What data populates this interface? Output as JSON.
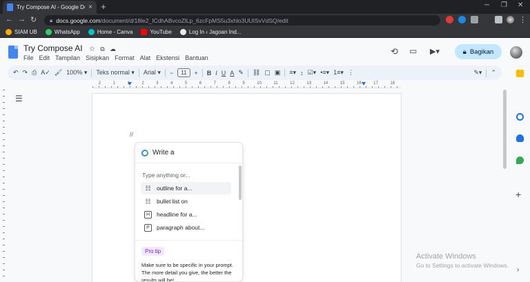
{
  "browser": {
    "tab_title": "Try Compose AI - Google Dokum",
    "new_tab": "+",
    "close": "×",
    "url_host": "docs.google.com",
    "url_path": "/document/d/18le2_ICdhABvcoZlLp_6zcFpMS5u3xhlo3UUISvVdSQ/edit",
    "bookmarks": [
      "SIAM UB",
      "WhatsApp",
      "Home - Canva",
      "YouTube",
      "Log In ‹ Jagoan Ind..."
    ]
  },
  "docs": {
    "title": "Try Compose AI",
    "menu": [
      "File",
      "Edit",
      "Tampilan",
      "Sisipkan",
      "Format",
      "Alat",
      "Ekstensi",
      "Bantuan"
    ],
    "share_label": "Bagikan",
    "toolbar": {
      "zoom": "100%",
      "style": "Teks normal",
      "font": "Arial",
      "font_size": "11"
    },
    "ruler_numbers": [
      "2",
      "1",
      "1",
      "2",
      "3",
      "4",
      "5",
      "6",
      "7",
      "8",
      "9",
      "10",
      "11",
      "12",
      "13",
      "14",
      "15",
      "16",
      "17",
      "18"
    ],
    "slashes": "//"
  },
  "compose": {
    "header": "Write a",
    "prompt_placeholder": "Type anything or...",
    "options": [
      {
        "icon": "list-icon",
        "label": "outline for a...",
        "active": true
      },
      {
        "icon": "bullet-list-icon",
        "label": "bullet list on",
        "active": false
      },
      {
        "icon": "heading-icon",
        "label": "headline for a...",
        "active": false
      },
      {
        "icon": "paragraph-icon",
        "label": "paragraph about...",
        "active": false
      }
    ],
    "protip_label": "Pro tip",
    "protip_text": "Make sure to be specific in your prompt. The more detail you give, the better the results will be!"
  },
  "watermark": {
    "title": "Activate Windows",
    "subtitle": "Go to Settings to activate Windows."
  }
}
